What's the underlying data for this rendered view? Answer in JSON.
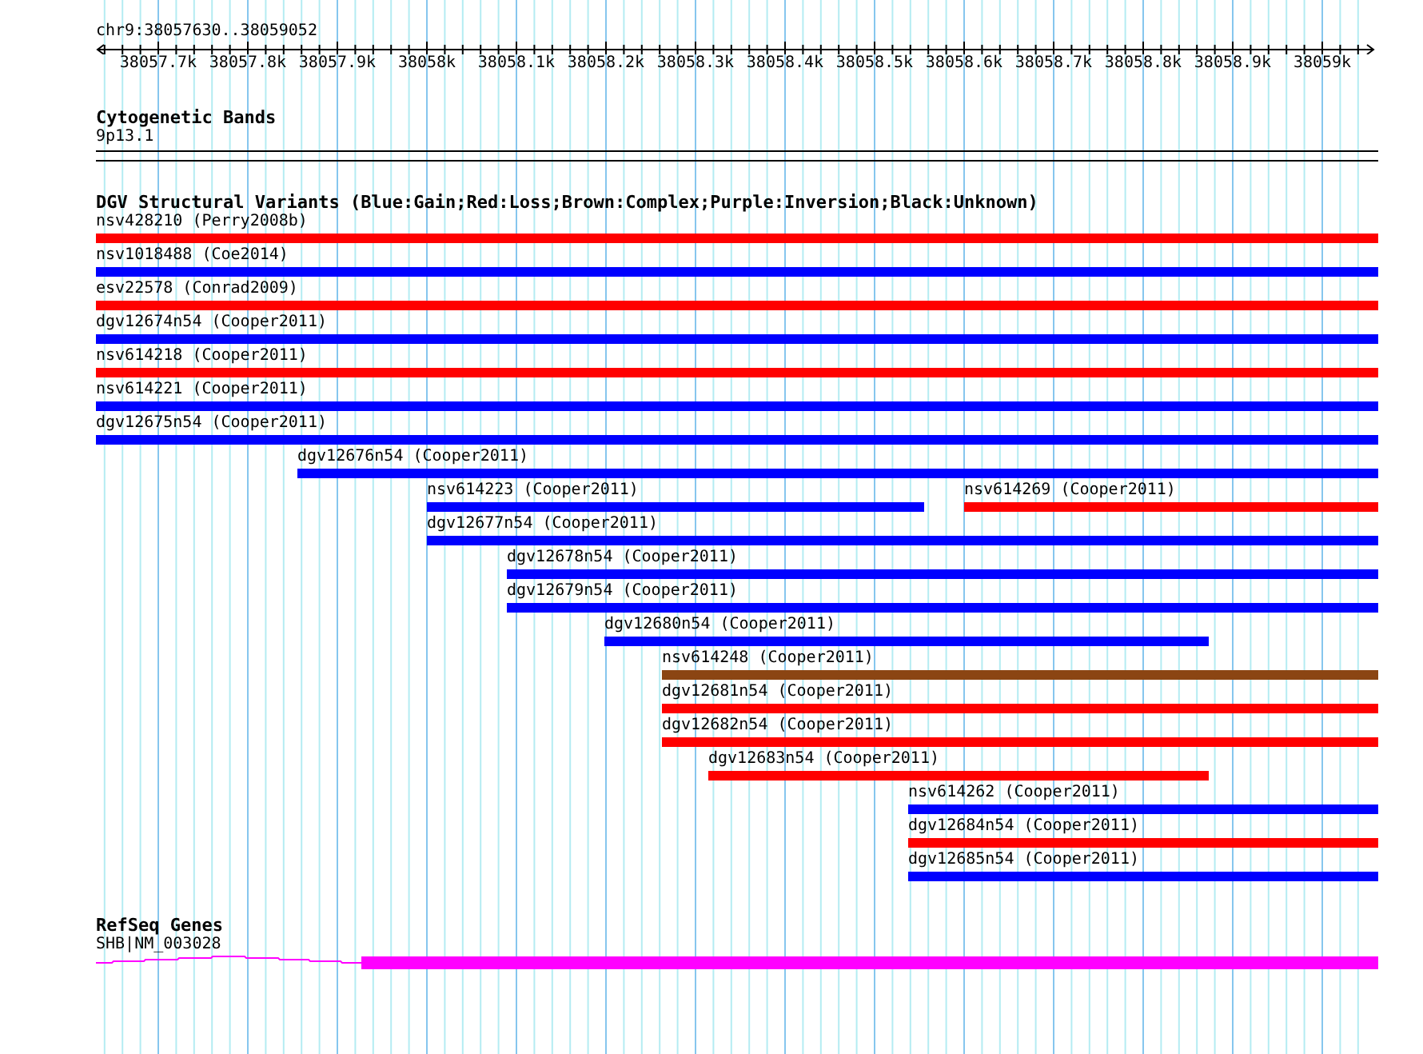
{
  "locus": "chr9:38057630..38059052",
  "ruler": {
    "ticks": [
      "38057.7k",
      "38057.8k",
      "38057.9k",
      "38058k",
      "38058.1k",
      "38058.2k",
      "38058.3k",
      "38058.4k",
      "38058.5k",
      "38058.6k",
      "38058.7k",
      "38058.8k",
      "38058.9k",
      "38059k"
    ]
  },
  "tracks": [
    {
      "kind": "bands",
      "title": "Cytogenetic Bands",
      "items": [
        {
          "label": "9p13.1"
        }
      ]
    },
    {
      "kind": "variants",
      "title": "DGV Structural Variants (Blue:Gain;Red:Loss;Brown:Complex;Purple:Inversion;Black:Unknown)",
      "rows": [
        {
          "features": [
            {
              "label": "nsv428210 (Perry2008b)",
              "color": "#ff0000"
            }
          ]
        },
        {
          "features": [
            {
              "label": "nsv1018488 (Coe2014)",
              "color": "#0000ff"
            }
          ]
        },
        {
          "features": [
            {
              "label": "esv22578 (Conrad2009)",
              "color": "#ff0000"
            }
          ]
        },
        {
          "features": [
            {
              "label": "dgv12674n54 (Cooper2011)",
              "color": "#0000ff"
            }
          ]
        },
        {
          "features": [
            {
              "label": "nsv614218 (Cooper2011)",
              "color": "#ff0000"
            }
          ]
        },
        {
          "features": [
            {
              "label": "nsv614221 (Cooper2011)",
              "color": "#0000ff"
            }
          ]
        },
        {
          "features": [
            {
              "label": "dgv12675n54 (Cooper2011)",
              "color": "#0000ff"
            }
          ]
        },
        {
          "features": [
            {
              "label": "dgv12676n54 (Cooper2011)",
              "color": "#0000ff"
            }
          ]
        },
        {
          "features": [
            {
              "label": "nsv614223 (Cooper2011)",
              "color": "#0000ff"
            },
            {
              "label": "nsv614269 (Cooper2011)",
              "color": "#ff0000"
            }
          ]
        },
        {
          "features": [
            {
              "label": "dgv12677n54 (Cooper2011)",
              "color": "#0000ff"
            }
          ]
        },
        {
          "features": [
            {
              "label": "dgv12678n54 (Cooper2011)",
              "color": "#0000ff"
            }
          ]
        },
        {
          "features": [
            {
              "label": "dgv12679n54 (Cooper2011)",
              "color": "#0000ff"
            }
          ]
        },
        {
          "features": [
            {
              "label": "dgv12680n54 (Cooper2011)",
              "color": "#0000ff"
            }
          ]
        },
        {
          "features": [
            {
              "label": "nsv614248 (Cooper2011)",
              "color": "#8b4513"
            }
          ]
        },
        {
          "features": [
            {
              "label": "dgv12681n54 (Cooper2011)",
              "color": "#ff0000"
            }
          ]
        },
        {
          "features": [
            {
              "label": "dgv12682n54 (Cooper2011)",
              "color": "#ff0000"
            }
          ]
        },
        {
          "features": [
            {
              "label": "dgv12683n54 (Cooper2011)",
              "color": "#ff0000"
            }
          ]
        },
        {
          "features": [
            {
              "label": "nsv614262 (Cooper2011)",
              "color": "#0000ff"
            }
          ]
        },
        {
          "features": [
            {
              "label": "dgv12684n54 (Cooper2011)",
              "color": "#ff0000"
            }
          ]
        },
        {
          "features": [
            {
              "label": "dgv12685n54 (Cooper2011)",
              "color": "#0000ff"
            }
          ]
        }
      ]
    },
    {
      "kind": "genes",
      "title": "RefSeq Genes",
      "items": [
        {
          "label": "SHB|NM_003028"
        }
      ]
    }
  ]
}
